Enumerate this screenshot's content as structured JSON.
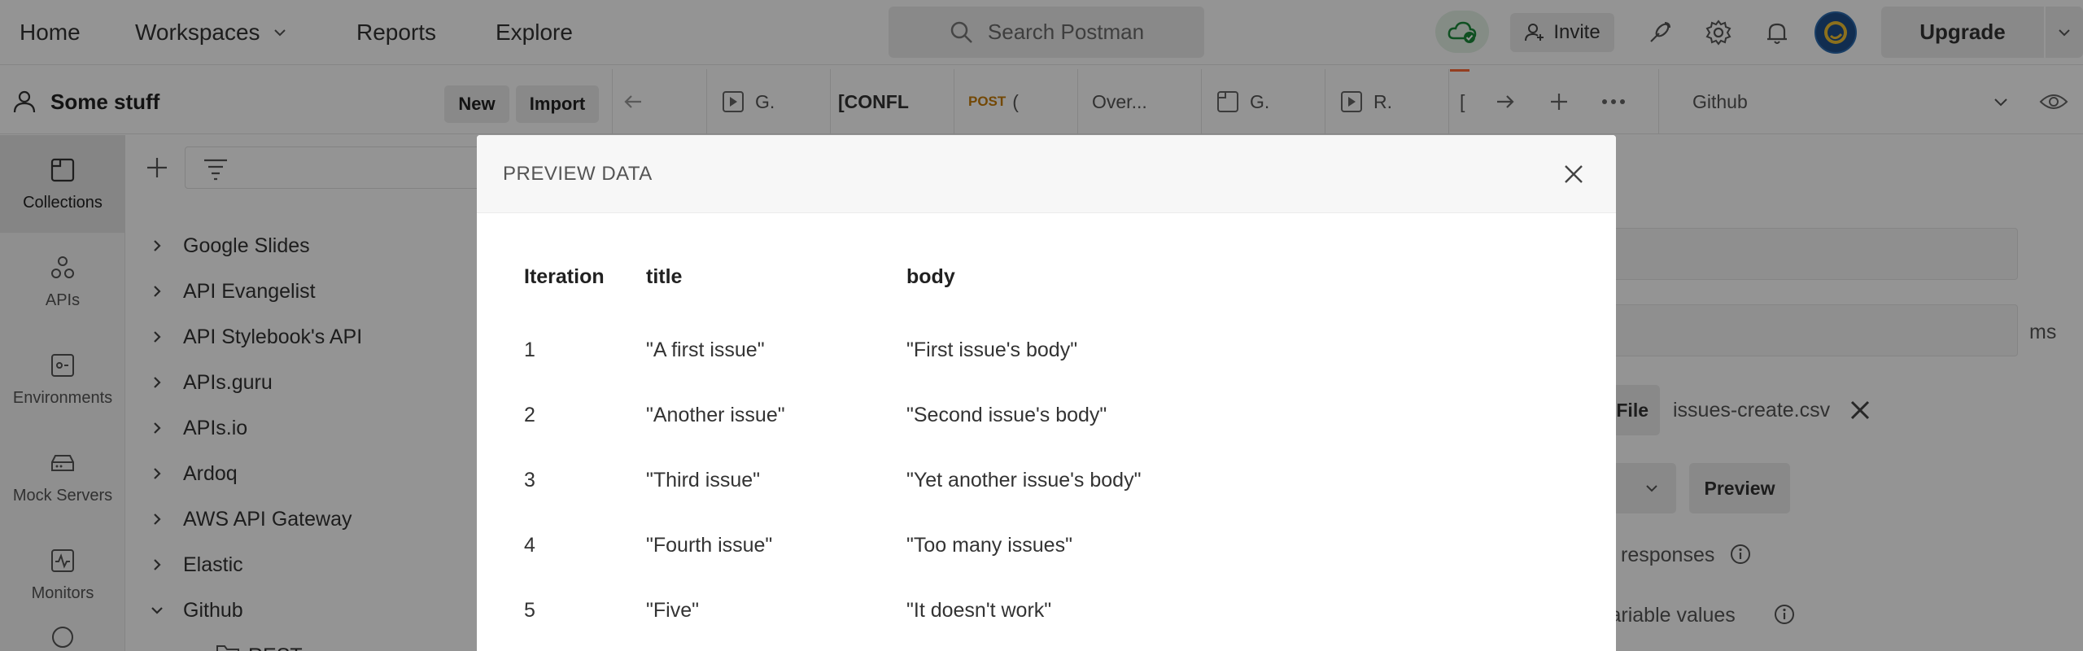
{
  "nav": {
    "home": "Home",
    "workspaces": "Workspaces",
    "reports": "Reports",
    "explore": "Explore",
    "search_placeholder": "Search Postman",
    "invite": "Invite",
    "upgrade": "Upgrade"
  },
  "workspace": {
    "name": "Some stuff",
    "new_label": "New",
    "import_label": "Import"
  },
  "tabs": [
    {
      "label": "G.",
      "icon": "runner-icon"
    },
    {
      "label": "[CONFL",
      "icon": ""
    },
    {
      "label": "(",
      "method": "POST"
    },
    {
      "label": "Over...",
      "icon": ""
    },
    {
      "label": "G.",
      "icon": "collection-icon"
    },
    {
      "label": "R.",
      "icon": "runner-icon"
    },
    {
      "label": "[",
      "icon": ""
    }
  ],
  "environment": {
    "selected": "Github"
  },
  "rail": [
    {
      "label": "Collections",
      "icon": "collections-icon"
    },
    {
      "label": "APIs",
      "icon": "apis-icon"
    },
    {
      "label": "Environments",
      "icon": "environments-icon"
    },
    {
      "label": "Mock Servers",
      "icon": "mock-servers-icon"
    },
    {
      "label": "Monitors",
      "icon": "monitors-icon"
    }
  ],
  "collections": [
    "Google Slides",
    "API Evangelist",
    "API Stylebook's API",
    "APIs.guru",
    "APIs.io",
    "Ardoq",
    "AWS API Gateway",
    "Elastic",
    "Github"
  ],
  "collection_child": "REST",
  "runner": {
    "ms_label": "ms",
    "file_button": "File",
    "file_name": "issues-create.csv",
    "preview_button": "Preview",
    "responses_label": "responses",
    "variable_values_label": "variable values"
  },
  "modal": {
    "title": "PREVIEW DATA",
    "columns": [
      "Iteration",
      "title",
      "body"
    ],
    "rows": [
      [
        "1",
        "\"A first issue\"",
        "\"First issue's body\""
      ],
      [
        "2",
        "\"Another issue\"",
        "\"Second issue's body\""
      ],
      [
        "3",
        "\"Third issue\"",
        "\"Yet another issue's body\""
      ],
      [
        "4",
        "\"Fourth issue\"",
        "\"Too many issues\""
      ],
      [
        "5",
        "\"Five\"",
        "\"It doesn't work\""
      ]
    ]
  },
  "colors": {
    "accent": "#ff6c37",
    "post_method": "#c77d0a",
    "cloud_ok": "#1a8a3a"
  }
}
